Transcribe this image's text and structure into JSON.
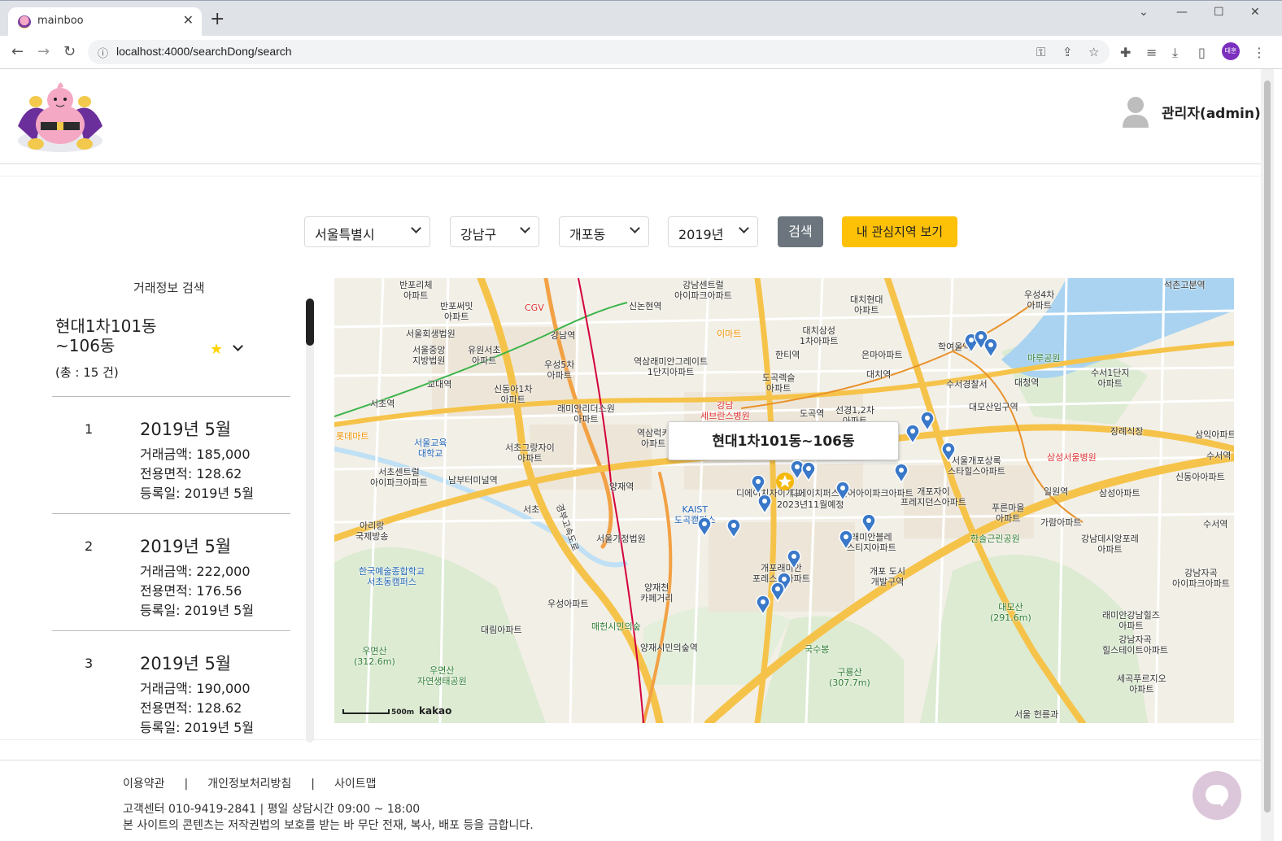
{
  "browser": {
    "tab_title": "mainboo",
    "tab_close": "✕",
    "new_tab": "+",
    "url": "localhost:4000/searchDong/search",
    "profile_initials": "태훈"
  },
  "header": {
    "user_label": "관리자(admin)"
  },
  "filters": {
    "city": "서울특별시",
    "district": "강남구",
    "dong": "개포동",
    "year": "2019년",
    "search_label": "검색",
    "interest_label": "내 관심지역 보기"
  },
  "panel": {
    "title": "거래정보 검색",
    "apartment_name_line1": "현대1차101동",
    "apartment_name_line2": "~106동",
    "star": "★",
    "total": "(총 : 15 건)",
    "deals": [
      {
        "index": "1",
        "date": "2019년 5월",
        "price": "거래금액: 185,000",
        "area": "전용면적: 128.62",
        "registered": "등록일: 2019년 5월"
      },
      {
        "index": "2",
        "date": "2019년 5월",
        "price": "거래금액: 222,000",
        "area": "전용면적: 176.56",
        "registered": "등록일: 2019년 5월"
      },
      {
        "index": "3",
        "date": "2019년 5월",
        "price": "거래금액: 190,000",
        "area": "전용면적: 128.62",
        "registered": "등록일: 2019년 5월"
      }
    ]
  },
  "map": {
    "popup_title": "현대1차101동~106동",
    "scale_text": "500m",
    "provider": "kakao",
    "labels": [
      {
        "text": "반포리체\n아파트",
        "tone": "black"
      },
      {
        "text": "반포써밋\n아파트",
        "tone": "black"
      },
      {
        "text": "CGV",
        "tone": "red"
      },
      {
        "text": "강남센트럴\n아이파크아파트",
        "tone": "black"
      },
      {
        "text": "대치현대\n아파트",
        "tone": "black"
      },
      {
        "text": "우성4차\n아파트",
        "tone": "black"
      },
      {
        "text": "석촌고분역",
        "tone": "black"
      },
      {
        "text": "신논현역",
        "tone": "black"
      },
      {
        "text": "서울회생법원",
        "tone": "black"
      },
      {
        "text": "강남역",
        "tone": "black"
      },
      {
        "text": "이마트",
        "tone": "orange"
      },
      {
        "text": "대치삼성\n1차아파트",
        "tone": "black"
      },
      {
        "text": "학여울역",
        "tone": "black"
      },
      {
        "text": "마루공원",
        "tone": "green"
      },
      {
        "text": "서울중앙\n지방법원",
        "tone": "black"
      },
      {
        "text": "유원서초\n아파트",
        "tone": "black"
      },
      {
        "text": "역삼래미안그레이트\n1단지아파트",
        "tone": "black"
      },
      {
        "text": "한티역",
        "tone": "black"
      },
      {
        "text": "은마아파트",
        "tone": "black"
      },
      {
        "text": "교대역",
        "tone": "black"
      },
      {
        "text": "우성5차\n아파트",
        "tone": "black"
      },
      {
        "text": "도곡렉슬\n아파트",
        "tone": "black"
      },
      {
        "text": "대치역",
        "tone": "black"
      },
      {
        "text": "수서경찰서",
        "tone": "black"
      },
      {
        "text": "대청역",
        "tone": "black"
      },
      {
        "text": "수서1단지\n아파트",
        "tone": "black"
      },
      {
        "text": "서초역",
        "tone": "black"
      },
      {
        "text": "신동아1차\n아파트",
        "tone": "black"
      },
      {
        "text": "래미안리더스원\n아파트",
        "tone": "black"
      },
      {
        "text": "강남\n세브란스병원",
        "tone": "red"
      },
      {
        "text": "도곡역",
        "tone": "black"
      },
      {
        "text": "선경1,2차\n아파트",
        "tone": "black"
      },
      {
        "text": "대모산입구역",
        "tone": "black"
      },
      {
        "text": "롯데마트",
        "tone": "orange"
      },
      {
        "text": "서울교육\n대학교",
        "tone": "blue"
      },
      {
        "text": "서초그랑자이\n아파트",
        "tone": "black"
      },
      {
        "text": "역삼럭키\n아파트",
        "tone": "black"
      },
      {
        "text": "장례식장",
        "tone": "black"
      },
      {
        "text": "삼익아파트",
        "tone": "black"
      },
      {
        "text": "삼성서울병원",
        "tone": "red"
      },
      {
        "text": "서울개포상록\n스타힐스아파트",
        "tone": "black"
      },
      {
        "text": "수서역",
        "tone": "black"
      },
      {
        "text": "서초센트럴\n아이파크아파트",
        "tone": "black"
      },
      {
        "text": "남부터미널역",
        "tone": "black"
      },
      {
        "text": "양재역",
        "tone": "black"
      },
      {
        "text": "디에이치자이개포",
        "tone": "black"
      },
      {
        "text": "디에이치퍼스티어아이파크아파트",
        "tone": "black"
      },
      {
        "text": "2023년11월예정",
        "tone": "black"
      },
      {
        "text": "개포자이\n프레지던스아파트",
        "tone": "black"
      },
      {
        "text": "일원역",
        "tone": "black"
      },
      {
        "text": "삼성아파트",
        "tone": "black"
      },
      {
        "text": "신동아아파트",
        "tone": "black"
      },
      {
        "text": "KAIST\n도곡캠퍼스",
        "tone": "blue"
      },
      {
        "text": "푸른마을\n아파트",
        "tone": "black"
      },
      {
        "text": "가람아파트",
        "tone": "black"
      },
      {
        "text": "수서역",
        "tone": "black"
      },
      {
        "text": "아리랑\n국제방송",
        "tone": "black"
      },
      {
        "text": "서울가정법원",
        "tone": "black"
      },
      {
        "text": "래미안블레\n스티지아파트",
        "tone": "black"
      },
      {
        "text": "한솔근린공원",
        "tone": "green"
      },
      {
        "text": "강남데시앙포레\n아파트",
        "tone": "black"
      },
      {
        "text": "한국예술종합학교\n서초동캠퍼스",
        "tone": "blue"
      },
      {
        "text": "양재천\n카페거리",
        "tone": "black"
      },
      {
        "text": "개포래미안\n포레스트아파트",
        "tone": "black"
      },
      {
        "text": "개포 도시\n개발구역",
        "tone": "black"
      },
      {
        "text": "강남자곡\n아이파크아파트",
        "tone": "black"
      },
      {
        "text": "우성아파트",
        "tone": "black"
      },
      {
        "text": "대모산\n(291.6m)",
        "tone": "green"
      },
      {
        "text": "래미안강남힐즈\n아파트",
        "tone": "black"
      },
      {
        "text": "대림아파트",
        "tone": "black"
      },
      {
        "text": "매헌시민의숲",
        "tone": "green"
      },
      {
        "text": "우면산\n(312.6m)",
        "tone": "green"
      },
      {
        "text": "양재시민의숲역",
        "tone": "black"
      },
      {
        "text": "국수봉",
        "tone": "green"
      },
      {
        "text": "강남자곡\n힐스테이트아파트",
        "tone": "black"
      },
      {
        "text": "우면산\n자연생태공원",
        "tone": "green"
      },
      {
        "text": "구룡산\n(307.7m)",
        "tone": "green"
      },
      {
        "text": "세곡푸르지오\n아파트",
        "tone": "black"
      },
      {
        "text": "서울 헌릉과",
        "tone": "black"
      },
      {
        "text": "서초",
        "tone": "black"
      },
      {
        "text": "경부고속도로",
        "tone": "black"
      }
    ]
  },
  "footer": {
    "links": [
      "이용약관",
      "개인정보처리방침",
      "사이트맵"
    ],
    "separator": "|",
    "contact": "고객센터 010-9419-2841 | 평일 상담시간 09:00 ~ 18:00",
    "copyright": "본 사이트의 콘텐츠는 저작권법의 보호를 받는 바 무단 전재, 복사, 배포 등을 금합니다."
  }
}
